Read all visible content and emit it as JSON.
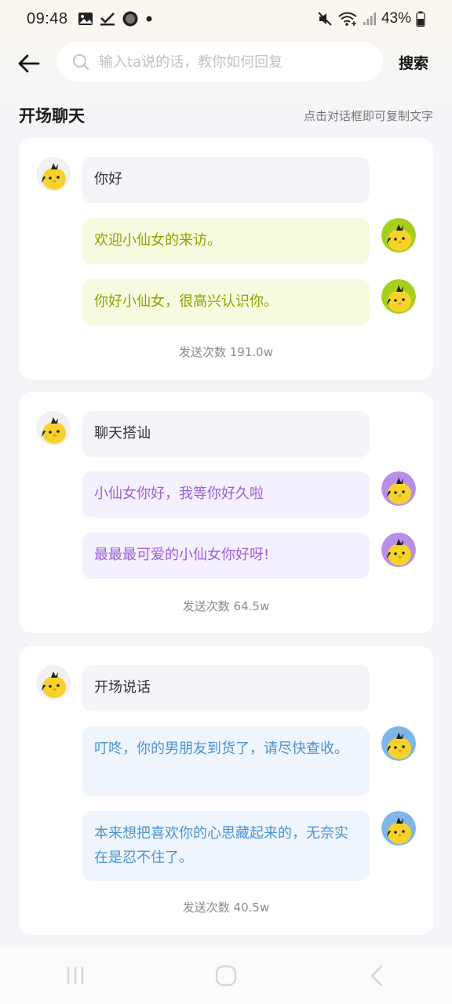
{
  "status_bar": {
    "time": "09:48",
    "battery": "43%"
  },
  "header": {
    "search_placeholder": "输入ta说的话，教你如何回复",
    "search_button": "搜索"
  },
  "section": {
    "title": "开场聊天",
    "hint": "点击对话框即可复制文字"
  },
  "colors": {
    "green_bubble": "#f6fbe0",
    "green_text": "#8aa400",
    "purple_bubble": "#f5f0fd",
    "purple_text": "#9b5fd6",
    "blue_bubble": "#eef5fd",
    "blue_text": "#4d93d0"
  },
  "cards": [
    {
      "question": "你好",
      "answers": [
        "欢迎小仙女的来访。",
        "你好小仙女，很高兴认识你。"
      ],
      "count": "发送次数 191.0w"
    },
    {
      "question": "聊天搭讪",
      "answers": [
        "小仙女你好，我等你好久啦",
        "最最最可爱的小仙女你好呀!"
      ],
      "count": "发送次数 64.5w"
    },
    {
      "question": "开场说话",
      "answers": [
        "叮咚，你的男朋友到货了，请尽快查收。",
        "本来想把喜欢你的心思藏起来的，无奈实在是忍不住了。"
      ],
      "count": "发送次数 40.5w"
    }
  ]
}
